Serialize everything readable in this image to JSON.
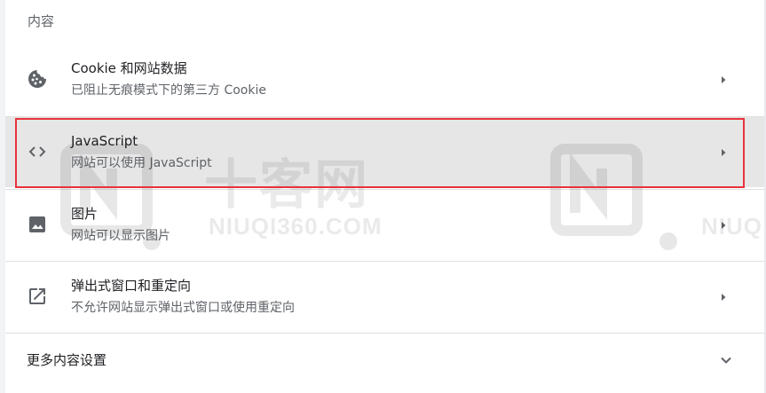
{
  "section": {
    "title": "内容"
  },
  "rows": [
    {
      "title": "Cookie 和网站数据",
      "subtitle": "已阻止无痕模式下的第三方 Cookie",
      "icon": "cookie-icon"
    },
    {
      "title": "JavaScript",
      "subtitle": "网站可以使用 JavaScript",
      "icon": "code-icon"
    },
    {
      "title": "图片",
      "subtitle": "网站可以显示图片",
      "icon": "image-icon"
    },
    {
      "title": "弹出式窗口和重定向",
      "subtitle": "不允许网站显示弹出式窗口或使用重定向",
      "icon": "external-link-icon"
    }
  ],
  "more": {
    "label": "更多内容设置"
  },
  "watermark": {
    "brand": "十客网",
    "domain": "NIUQI360.COM",
    "domain_partial": "NIUQ"
  },
  "colors": {
    "highlight_border": "#e8323c",
    "highlight_row_bg": "#e6e6e6",
    "icon": "#5f6368",
    "title_text": "#202124",
    "subtitle_text": "#5f6368"
  }
}
